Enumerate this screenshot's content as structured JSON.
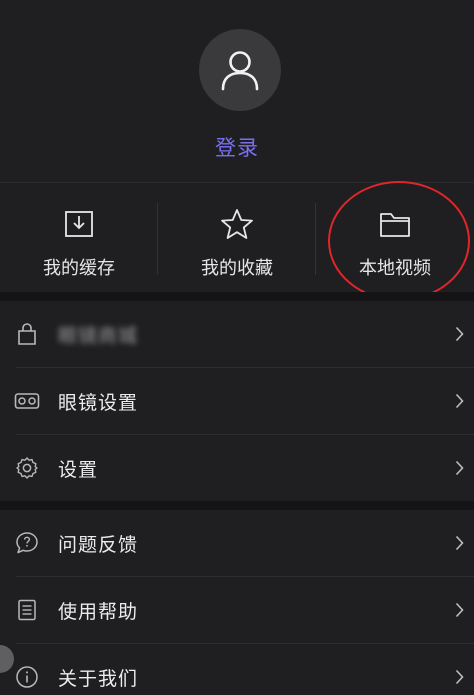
{
  "profile": {
    "avatar_icon": "user-icon",
    "login_label": "登录",
    "login_color": "#7a6ff0"
  },
  "quick_actions": [
    {
      "label": "我的缓存",
      "icon": "download-tray-icon"
    },
    {
      "label": "我的收藏",
      "icon": "star-icon"
    },
    {
      "label": "本地视频",
      "icon": "folder-icon"
    }
  ],
  "annotation": {
    "ring_color": "#e0262a"
  },
  "menu": {
    "group1": [
      {
        "label": "眼镜商城",
        "icon": "shopping-bag-icon",
        "blurred": true
      },
      {
        "label": "眼镜设置",
        "icon": "vr-glasses-icon"
      },
      {
        "label": "设置",
        "icon": "gear-icon"
      }
    ],
    "group2": [
      {
        "label": "问题反馈",
        "icon": "question-bubble-icon"
      },
      {
        "label": "使用帮助",
        "icon": "list-doc-icon"
      },
      {
        "label": "关于我们",
        "icon": "info-icon"
      }
    ]
  }
}
